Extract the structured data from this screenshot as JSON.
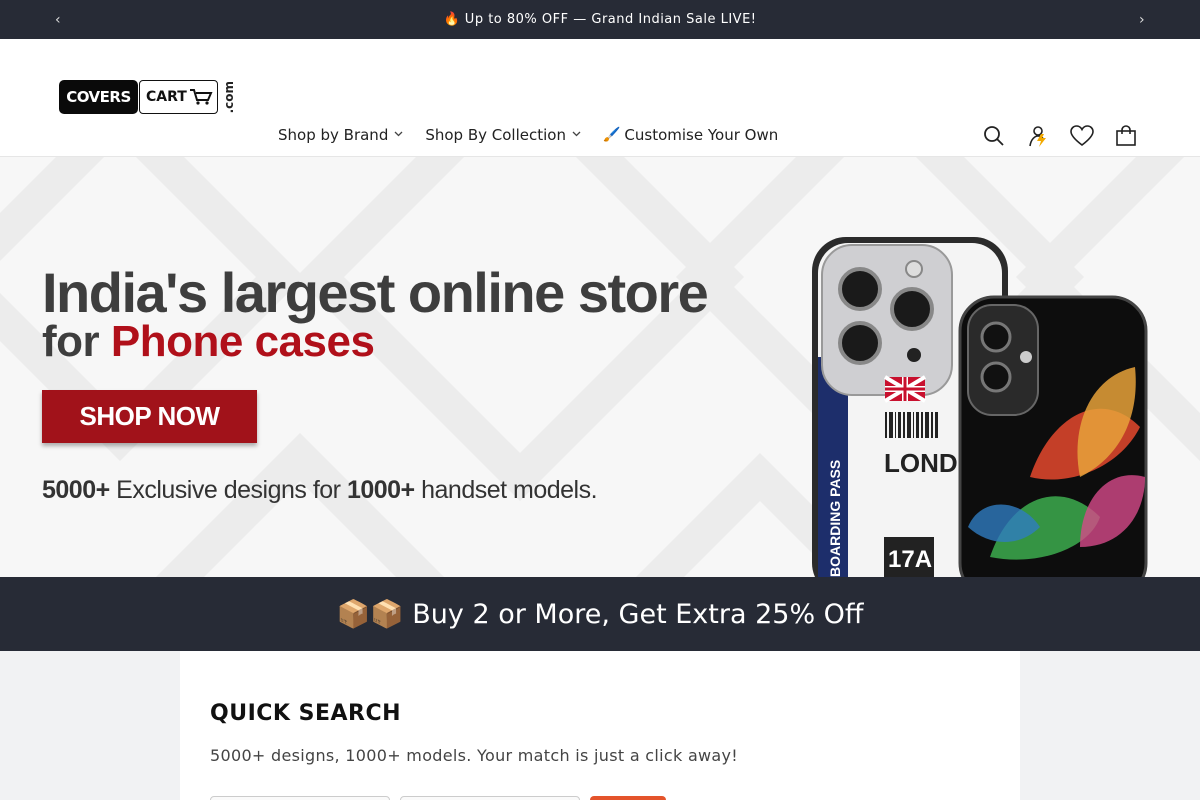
{
  "announcement": {
    "text": "🔥 Up to 80% OFF — Grand Indian Sale LIVE!",
    "prev_glyph": "‹",
    "next_glyph": "›"
  },
  "header": {
    "logo": {
      "part1": "COVERS",
      "part2": "CART",
      "part3": ".com"
    },
    "nav": [
      {
        "label": "Shop by Brand",
        "has_dropdown": true
      },
      {
        "label": "Shop By Collection",
        "has_dropdown": true
      },
      {
        "label": "Customise Your Own",
        "icon": "paintbrush-icon",
        "glyph": "🖌️"
      }
    ],
    "icons": [
      "search-icon",
      "account-icon",
      "wishlist-icon",
      "cart-icon"
    ]
  },
  "hero": {
    "headline": "India's largest online store",
    "subheadline_prefix": "for ",
    "subheadline_highlight": "Phone cases",
    "cta": "SHOP NOW",
    "tagline_bold1": "5000+",
    "tagline_mid": " Exclusive designs for ",
    "tagline_bold2": "1000+",
    "tagline_end": " handset models.",
    "phone_texts": [
      "LONDON",
      "17A",
      "BOARDING PASS"
    ]
  },
  "promo": {
    "text": "📦📦 Buy 2 or More, Get Extra 25% Off"
  },
  "quick_search": {
    "title": "QUICK SEARCH",
    "subtitle": "5000+ designs, 1000+ models. Your match is just a click away!"
  },
  "colors": {
    "dark": "#272b36",
    "accent_red": "#a1121a",
    "highlight_red": "#b0101a",
    "button_orange": "#e4542b"
  }
}
